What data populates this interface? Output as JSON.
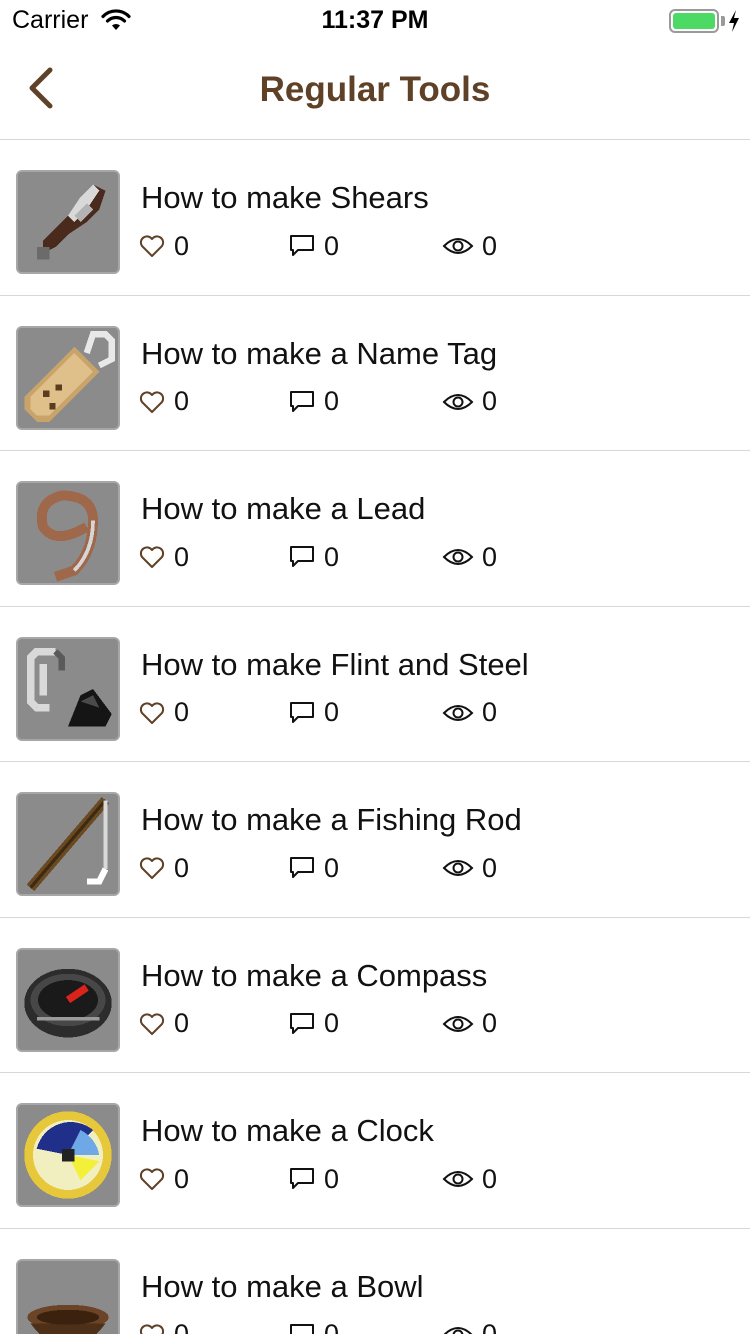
{
  "status_bar": {
    "carrier": "Carrier",
    "time": "11:37 PM"
  },
  "nav": {
    "title": "Regular Tools",
    "back_icon": "chevron-left-icon"
  },
  "colors": {
    "accent": "#5e4126",
    "battery": "#4cd964",
    "divider": "#d8d8d8"
  },
  "items": [
    {
      "title": "How to make Shears",
      "likes": "0",
      "comments": "0",
      "views": "0",
      "icon": "shears-icon"
    },
    {
      "title": "How to make a Name Tag",
      "likes": "0",
      "comments": "0",
      "views": "0",
      "icon": "name-tag-icon"
    },
    {
      "title": "How to make a Lead",
      "likes": "0",
      "comments": "0",
      "views": "0",
      "icon": "lead-icon"
    },
    {
      "title": "How to make Flint and Steel",
      "likes": "0",
      "comments": "0",
      "views": "0",
      "icon": "flint-and-steel-icon"
    },
    {
      "title": "How to make a Fishing Rod",
      "likes": "0",
      "comments": "0",
      "views": "0",
      "icon": "fishing-rod-icon"
    },
    {
      "title": "How to make a Compass",
      "likes": "0",
      "comments": "0",
      "views": "0",
      "icon": "compass-icon"
    },
    {
      "title": "How to make a Clock",
      "likes": "0",
      "comments": "0",
      "views": "0",
      "icon": "clock-icon"
    },
    {
      "title": "How to make a Bowl",
      "likes": "0",
      "comments": "0",
      "views": "0",
      "icon": "bowl-icon"
    }
  ]
}
